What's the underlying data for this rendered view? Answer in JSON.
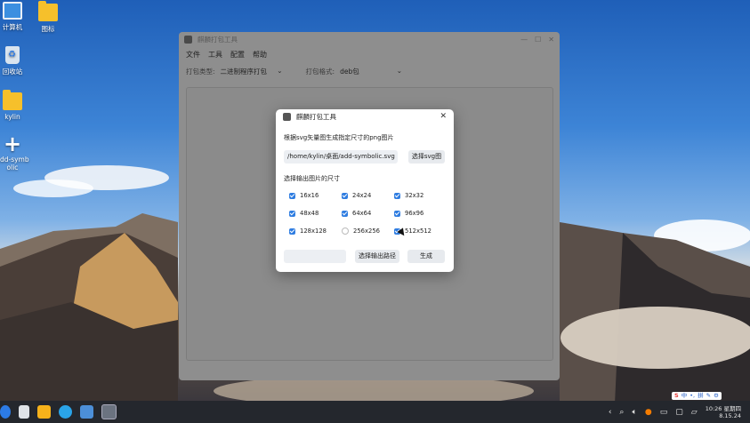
{
  "desktop": {
    "icons": [
      {
        "label": "计算机"
      },
      {
        "label": "图标"
      },
      {
        "label": "回收站"
      },
      {
        "label": "kylin"
      },
      {
        "label": "add-symbolic"
      }
    ]
  },
  "main_window": {
    "title": "麒麟打包工具",
    "menu": [
      "文件",
      "工具",
      "配置",
      "帮助"
    ],
    "package_type_label": "打包类型:",
    "package_type_value": "二进制程序打包",
    "package_format_label": "打包格式:",
    "package_format_value": "deb包"
  },
  "dialog": {
    "title": "麒麟打包工具",
    "description": "根据svg矢量图生成指定尺寸的png图片",
    "svg_path": "/home/kylin/桌面/add-symbolic.svg",
    "select_svg_button": "选择svg图",
    "size_label": "选择输出图片的尺寸",
    "sizes": [
      {
        "label": "16x16",
        "checked": true
      },
      {
        "label": "24x24",
        "checked": true
      },
      {
        "label": "32x32",
        "checked": true
      },
      {
        "label": "48x48",
        "checked": true
      },
      {
        "label": "64x64",
        "checked": true
      },
      {
        "label": "96x96",
        "checked": true
      },
      {
        "label": "128x128",
        "checked": true
      },
      {
        "label": "256x256",
        "checked": false
      },
      {
        "label": "512x512",
        "checked": true
      }
    ],
    "output_path_value": "",
    "select_output_button": "选择输出路径",
    "generate_button": "生成"
  },
  "taskbar": {
    "ime": [
      "中",
      "•,",
      "拼"
    ],
    "clock_time": "10:26 星期四",
    "clock_date": "8.15.24"
  },
  "colors": {
    "accent": "#2f7de1",
    "taskbar": "#24272d"
  }
}
